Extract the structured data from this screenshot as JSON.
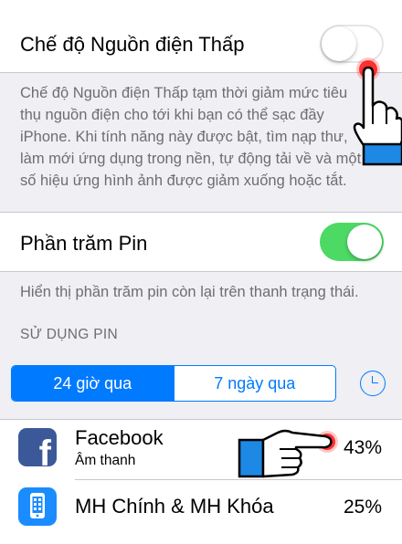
{
  "low_power": {
    "label": "Chế độ Nguồn điện Thấp",
    "enabled": false,
    "description_lines": [
      "Chế độ Nguồn điện Thấp tạm thời giảm mức tiêu",
      "thụ nguồn điện cho tới khi bạn có thể sạc đầy",
      "iPhone. Khi tính năng này được bật, tìm nạp thư,",
      "làm mới ứng dụng trong nền, tự động tải về và một",
      "số hiệu ứng hình ảnh được giảm xuống hoặc tắt."
    ]
  },
  "battery_percentage": {
    "label": "Phần trăm Pin",
    "enabled": true,
    "description": "Hiển thị phần trăm pin còn lại trên thanh trạng thái."
  },
  "usage": {
    "header": "SỬ DỤNG PIN",
    "segments": [
      "24 giờ qua",
      "7 ngày qua"
    ],
    "selected_segment": "24 giờ qua",
    "apps": [
      {
        "name": "Facebook",
        "subtitle": "Âm thanh",
        "percent": "43%",
        "icon": "facebook-icon"
      },
      {
        "name": "MH Chính & MH Khóa",
        "subtitle": "",
        "percent": "25%",
        "icon": "home-lock-screen-icon"
      }
    ]
  },
  "colors": {
    "accent": "#007aff",
    "toggle_on": "#4cd964",
    "background": "#efeff4",
    "tap_marker": "#ff2020"
  }
}
